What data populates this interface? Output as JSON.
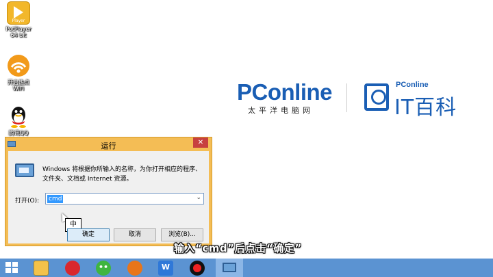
{
  "desktop": {
    "icons": [
      {
        "label": "PotPlayer 64 bit",
        "badge": "Player"
      },
      {
        "label": "开启热点 WiFi"
      },
      {
        "label": "腾讯QQ"
      }
    ]
  },
  "branding": {
    "pconline_wordmark": "PConline",
    "pconline_sub": "太平洋电脑网",
    "it_small": "PConline",
    "it_big": "IT百科"
  },
  "run_dialog": {
    "title": "运行",
    "close_glyph": "✕",
    "description": "Windows 将根据你所输入的名称，为你打开相应的程序、文件夹、文档或 Internet 资源。",
    "open_label": "打开(O):",
    "input_value": "cmd",
    "dropdown_arrow": "⌄",
    "ime_indicator": "中",
    "buttons": {
      "ok": "确定",
      "cancel": "取消",
      "browse": "浏览(B)..."
    }
  },
  "subtitle": "输入“cmd”后点击“确定”",
  "taskbar": {
    "wechat_glyph": "••",
    "wps_glyph": "W"
  },
  "colors": {
    "accent_blue": "#1a5eb4",
    "taskbar": "#5b93d2",
    "dialog_frame": "#f4bd55"
  }
}
